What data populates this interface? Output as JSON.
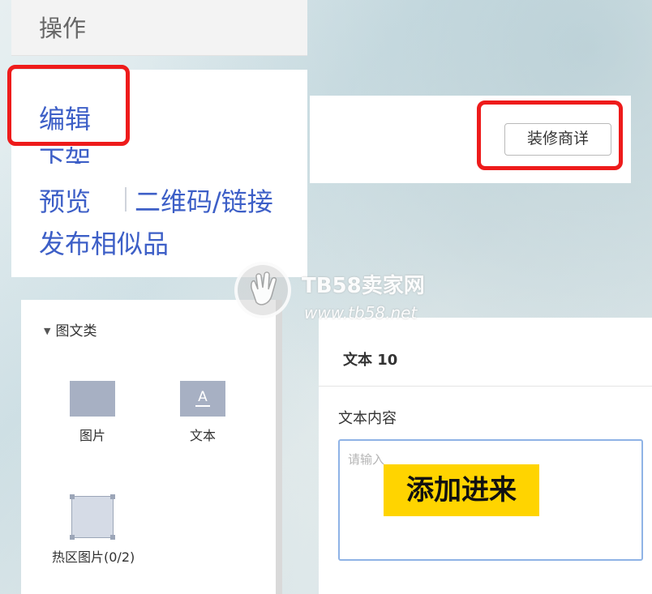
{
  "ops": {
    "title": "操作",
    "links": {
      "edit": "编辑",
      "delist": "下架",
      "preview": "预览",
      "qrcode": "二维码/链接",
      "publish_similar": "发布相似品"
    }
  },
  "decorate": {
    "button_label": "装修商详"
  },
  "components": {
    "category": "图文类",
    "items": [
      {
        "label": "图片",
        "icon": "image-icon"
      },
      {
        "label": "文本",
        "icon": "text-icon",
        "glyph": "A"
      },
      {
        "label": "热区图片(0/2)",
        "icon": "hotspot-icon"
      }
    ]
  },
  "text_editor": {
    "title": "文本 10",
    "content_label": "文本内容",
    "placeholder": "请输入"
  },
  "callout": {
    "text": "添加进来"
  },
  "watermark": {
    "name": "TB58卖家网",
    "url": "www.tb58.net"
  },
  "colors": {
    "highlight": "#ee1b1b",
    "link": "#3d5fc7",
    "callout": "#ffd400"
  }
}
